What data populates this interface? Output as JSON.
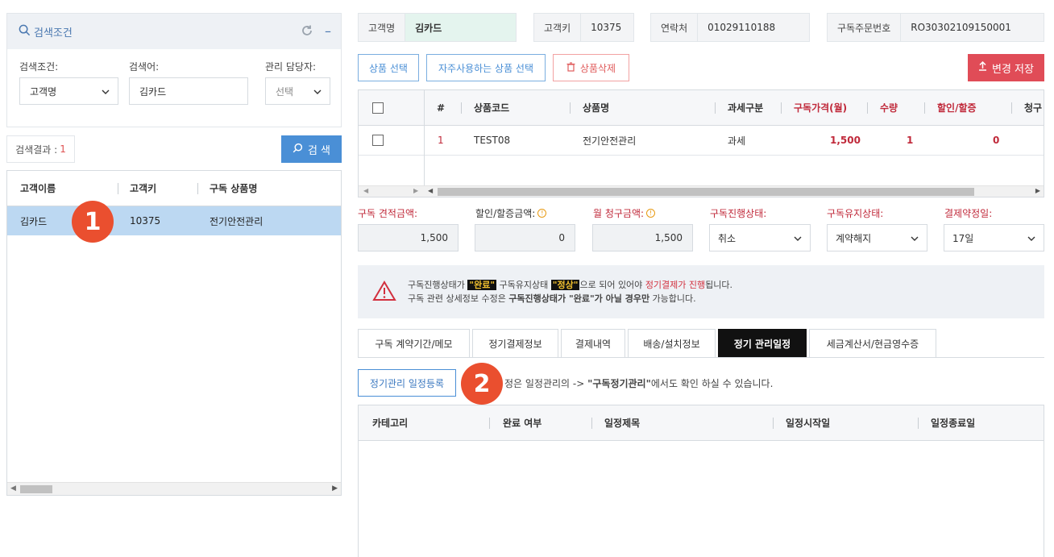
{
  "search_panel": {
    "title": "검색조건",
    "condition_label": "검색조건:",
    "condition_value": "고객명",
    "keyword_label": "검색어:",
    "keyword_value": "김카드",
    "manager_label": "관리 담당자:",
    "manager_value": "선택",
    "result_label": "검색결과 :",
    "result_count": "1",
    "search_button": "검 색"
  },
  "result_list": {
    "columns": [
      "고객이름",
      "고객키",
      "구독 상품명"
    ],
    "rows": [
      {
        "name": "김카드",
        "key": "10375",
        "product": "전기안전관리"
      }
    ]
  },
  "markers": [
    "1",
    "2"
  ],
  "header_info": {
    "customer_name_label": "고객명",
    "customer_name": "김카드",
    "customer_key_label": "고객키",
    "customer_key": "10375",
    "contact_label": "연락처",
    "contact": "01029110188",
    "order_no_label": "구독주문번호",
    "order_no": "RO30302109150001"
  },
  "actions": {
    "select_product": "상품 선택",
    "select_frequent": "자주사용하는 상품 선택",
    "delete_product": "상품삭제",
    "save_changes": "변경 저장"
  },
  "product_grid": {
    "columns": [
      "#",
      "상품코드",
      "상품명",
      "과세구분",
      "구독가격(월)",
      "수량",
      "할인/할증",
      "청구"
    ],
    "rows": [
      {
        "no": "1",
        "code": "TEST08",
        "name": "전기안전관리",
        "tax": "과세",
        "price": "1,500",
        "qty": "1",
        "discount": "0"
      }
    ]
  },
  "amounts": {
    "estimate_label": "구독 견적금액:",
    "estimate_value": "1,500",
    "discount_label": "할인/할증금액:",
    "discount_value": "0",
    "monthly_label": "월 청구금액:",
    "monthly_value": "1,500",
    "progress_label": "구독진행상태:",
    "progress_value": "취소",
    "maintain_label": "구독유지상태:",
    "maintain_value": "계약해지",
    "payday_label": "결제약정일:",
    "payday_value": "17일"
  },
  "notice": {
    "l1_a": "구독진행상태가 ",
    "l1_tag1": "\"완료\"",
    "l1_b": " 구독유지상태 ",
    "l1_tag2": "\"정상\"",
    "l1_c": "으로 되어 있어야 ",
    "l1_red": "정기결제가 진행",
    "l1_d": "됩니다.",
    "l2_a": "구독 관련 상세정보 수정은 ",
    "l2_bold": "구독진행상태가 \"완료\"가 아닐 경우만",
    "l2_b": " 가능합니다."
  },
  "tabs": [
    "구독 계약기간/메모",
    "정기결제정보",
    "결제내역",
    "배송/설치정보",
    "정기 관리일정",
    "세금계산서/현금영수증"
  ],
  "schedule": {
    "register_button": "정기관리 일정등록",
    "note_a": "정은 일정관리의 -> ",
    "note_bold": "\"구독정기관리\"",
    "note_b": "에서도 확인 하실 수 있습니다.",
    "columns": [
      "카테고리",
      "완료 여부",
      "일정제목",
      "일정시작일",
      "일정종료일"
    ]
  }
}
